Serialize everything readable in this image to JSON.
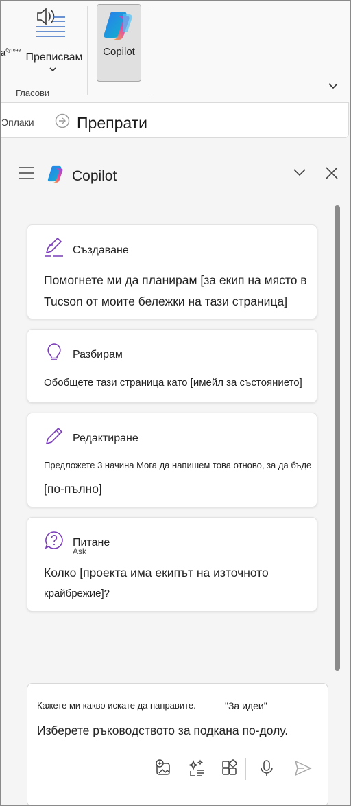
{
  "ribbon": {
    "partial_label": "а",
    "partial_sup": "бутоне",
    "transcribe_label": "Преписвам",
    "group_label": "Гласови",
    "copilot_label": "Copilot"
  },
  "titlebar": {
    "crumb": "Ͻплаки",
    "page_title": "Препрати"
  },
  "pane": {
    "title": "Copilot",
    "cards": [
      {
        "title": "Създаване",
        "lines": [
          "Помогнете ми да планирам [за екип на място в",
          "Tucson от моите бележки на тази страница]"
        ]
      },
      {
        "title": "Разбирам",
        "lines": [
          "Обобщете тази страница като [имейл за състоянието]"
        ]
      },
      {
        "title": "Редактиране",
        "lines": [
          "Предложете 3 начина  Мога да напишем това отново, за да бъде",
          "[по-пълно]"
        ]
      },
      {
        "title": "Питане",
        "strike": "Ask",
        "lines": [
          "Колко [проекта има екипът на източното",
          "крайбрежие]?"
        ]
      }
    ]
  },
  "input": {
    "hint_line1": "Кажете ми какво искате да направите.",
    "hint_quote": "\"За идеи\"",
    "hint_line2": "Изберете ръководството за подкана по-долу."
  },
  "icons": {
    "accent": "#7a3db8",
    "copilot_colors": [
      "#2a7bf0",
      "#12b5c9",
      "#f4a53a",
      "#e04d9b"
    ]
  }
}
